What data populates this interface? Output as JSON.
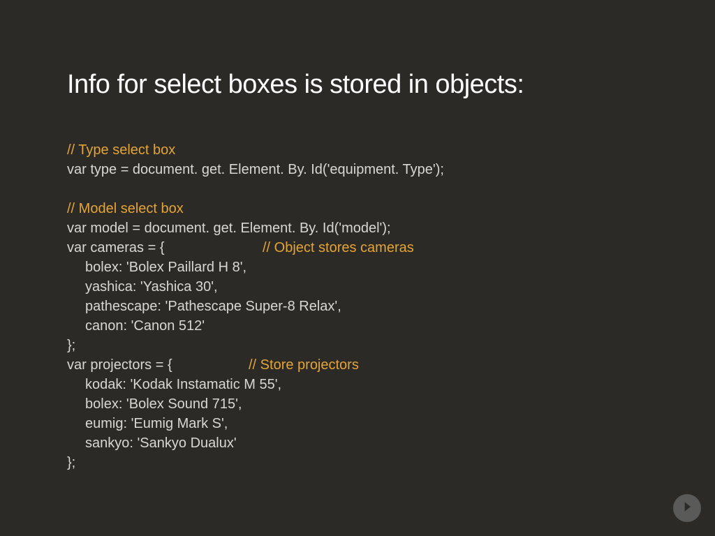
{
  "title": "Info for select boxes is stored in objects:",
  "code": {
    "section1": {
      "comment": "// Type select box",
      "line1": "var type  = document. get. Element. By. Id('equipment. Type');"
    },
    "section2": {
      "comment": "// Model select box",
      "line1": "var model = document. get. Element. By. Id('model');",
      "line2a": "var cameras = {",
      "line2b": "// Object stores cameras",
      "line3": "bolex: 'Bolex Paillard H 8',",
      "line4": "yashica: 'Yashica 30',",
      "line5": "pathescape: 'Pathescape Super-8 Relax',",
      "line6": "canon: 'Canon 512'",
      "line7": "};",
      "line8a": "var projectors = {",
      "line8b": "// Store projectors",
      "line9": "kodak: 'Kodak Instamatic M 55',",
      "line10": "bolex: 'Bolex Sound 715',",
      "line11": "eumig: 'Eumig Mark S',",
      "line12": "sankyo: 'Sankyo Dualux'",
      "line13": "};"
    }
  }
}
